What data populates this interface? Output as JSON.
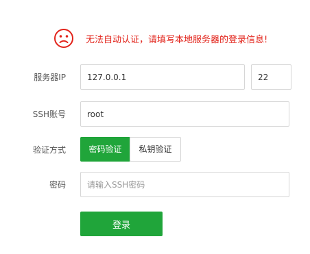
{
  "alert": {
    "icon": "sad-face-icon",
    "message": "无法自动认证，请填写本地服务器的登录信息!",
    "color": "#e2231a"
  },
  "form": {
    "server_ip": {
      "label": "服务器IP",
      "value": "127.0.0.1",
      "port_value": "22"
    },
    "ssh_account": {
      "label": "SSH账号",
      "value": "root"
    },
    "auth_method": {
      "label": "验证方式",
      "options": [
        "密码验证",
        "私钥验证"
      ],
      "selected": "密码验证"
    },
    "password": {
      "label": "密码",
      "value": "",
      "placeholder": "请输入SSH密码"
    },
    "submit_label": "登录"
  },
  "colors": {
    "accent": "#20a53a",
    "error": "#e2231a",
    "border": "#d6d6d6"
  }
}
